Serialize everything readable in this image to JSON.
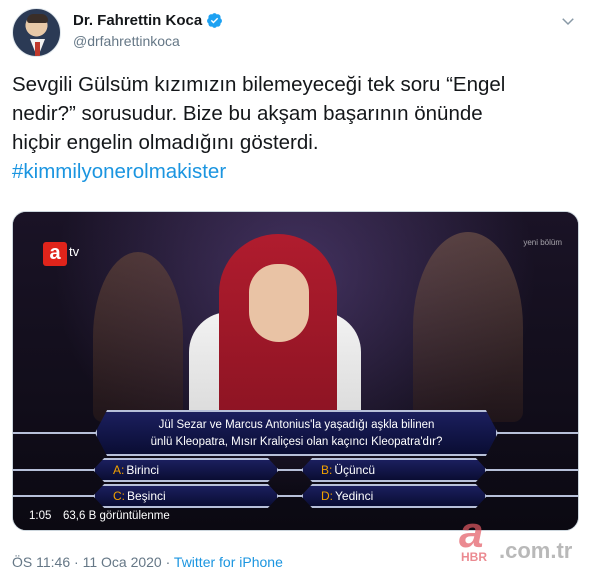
{
  "author": {
    "display_name": "Dr. Fahrettin Koca",
    "handle": "@drfahrettinkoca",
    "verified": true
  },
  "tweet": {
    "text_lines": [
      "Sevgili Gülsüm kızımızın bilemeyeceği tek soru “Engel",
      "nedir?” sorusudur. Bize bu akşam başarının önünde",
      "hiçbir engelin olmadığını gösterdi."
    ],
    "hashtag": "#kimmilyonerolmakister"
  },
  "media": {
    "channel_logo": "a",
    "channel_suffix": "tv",
    "corner_note": "yeni bölüm",
    "question_line1": "Jül Sezar ve Marcus Antonius'la yaşadığı aşkla bilinen",
    "question_line2": "ünlü Kleopatra, Mısır Kraliçesi olan kaçıncı Kleopatra'dır?",
    "answers": [
      {
        "letter": "A:",
        "text": "Birinci"
      },
      {
        "letter": "B:",
        "text": "Üçüncü"
      },
      {
        "letter": "C:",
        "text": "Beşinci"
      },
      {
        "letter": "D:",
        "text": "Yedinci"
      }
    ],
    "elapsed": "1:05",
    "views": "63,6 B görüntülenme"
  },
  "meta": {
    "time": "ÖS 11:46",
    "separator": "·",
    "date": "11 Oca 2020",
    "source": "Twitter for iPhone"
  },
  "watermark": {
    "mark": "a",
    "brand": "HBR",
    "domain": ".com.tr"
  },
  "colors": {
    "link": "#1b95e0",
    "muted": "#657786",
    "verified": "#1da1f2",
    "answer_letter": "#f0a000"
  },
  "icons": [
    "verified-badge-icon",
    "chevron-down-icon"
  ]
}
